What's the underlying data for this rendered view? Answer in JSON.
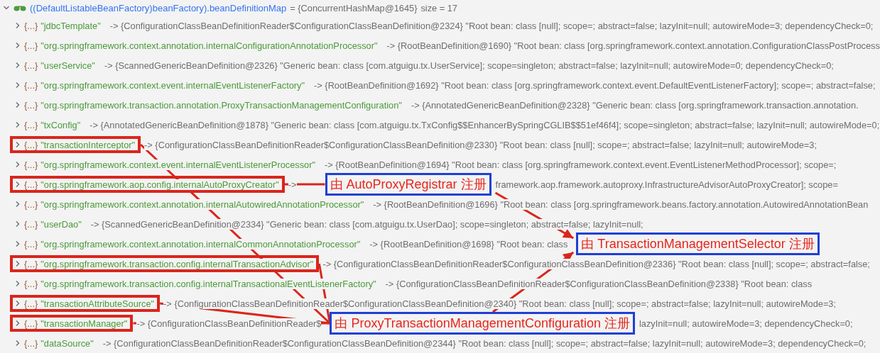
{
  "header": {
    "expression": "((DefaultListableBeanFactory)beanFactory).beanDefinitionMap",
    "value": "= {ConcurrentHashMap@1645}",
    "size": "size = 17",
    "expanded": true
  },
  "rows": [
    {
      "badge": "{...}",
      "key": "\"jdbcTemplate\"",
      "value": "-> {ConfigurationClassBeanDefinitionReader$ConfigurationClassBeanDefinition@2324} \"Root bean: class [null]; scope=; abstract=false; lazyInit=null; autowireMode=3; dependencyCheck=0;",
      "highlighted": false
    },
    {
      "badge": "{...}",
      "key": "\"org.springframework.context.annotation.internalConfigurationAnnotationProcessor\"",
      "value": "-> {RootBeanDefinition@1690} \"Root bean: class [org.springframework.context.annotation.ConfigurationClassPostProcess",
      "highlighted": false
    },
    {
      "badge": "{...}",
      "key": "\"userService\"",
      "value": "-> {ScannedGenericBeanDefinition@2326} \"Generic bean: class [com.atguigu.tx.UserService]; scope=singleton; abstract=false; lazyInit=null; autowireMode=0; dependencyCheck=0;",
      "highlighted": false
    },
    {
      "badge": "{...}",
      "key": "\"org.springframework.context.event.internalEventListenerFactory\"",
      "value": "-> {RootBeanDefinition@1692} \"Root bean: class [org.springframework.context.event.DefaultEventListenerFactory]; scope=; abstract=false;",
      "highlighted": false
    },
    {
      "badge": "{...}",
      "key": "\"org.springframework.transaction.annotation.ProxyTransactionManagementConfiguration\"",
      "value": "-> {AnnotatedGenericBeanDefinition@2328} \"Generic bean: class [org.springframework.transaction.annotation.",
      "highlighted": false
    },
    {
      "badge": "{...}",
      "key": "\"txConfig\"",
      "value": "-> {AnnotatedGenericBeanDefinition@1878} \"Generic bean: class [com.atguigu.tx.TxConfig$$EnhancerBySpringCGLIB$$51ef46f4]; scope=singleton; abstract=false; lazyInit=null; autowireMode=0;",
      "highlighted": false
    },
    {
      "badge": "{...}",
      "key": "\"transactionInterceptor\"",
      "value": "-> {ConfigurationClassBeanDefinitionReader$ConfigurationClassBeanDefinition@2330} \"Root bean: class [null]; scope=; abstract=false; lazyInit=null; autowireMode=3;",
      "highlighted": true
    },
    {
      "badge": "{...}",
      "key": "\"org.springframework.context.event.internalEventListenerProcessor\"",
      "value": "-> {RootBeanDefinition@1694} \"Root bean: class [org.springframework.context.event.EventListenerMethodProcessor]; scope=;",
      "highlighted": false
    },
    {
      "badge": "{...}",
      "key": "\"org.springframework.aop.config.internalAutoProxyCreator\"",
      "value": "->",
      "highlighted": true,
      "note": {
        "text": "由 AutoProxyRegistrar 注册"
      },
      "tail": "framework.aop.framework.autoproxy.InfrastructureAdvisorAutoProxyCreator]; scope="
    },
    {
      "badge": "{...}",
      "key": "\"org.springframework.context.annotation.internalAutowiredAnnotationProcessor\"",
      "value": "-> {RootBeanDefinition@1696} \"Root bean: class [org.springframework.beans.factory.annotation.AutowiredAnnotationBean",
      "highlighted": false
    },
    {
      "badge": "{...}",
      "key": "\"userDao\"",
      "value": "-> {ScannedGenericBeanDefinition@2334} \"Generic bean: class [com.atguigu.tx.UserDao]; scope=singleton; abstract=false; lazyInit=null;",
      "highlighted": false
    },
    {
      "badge": "{...}",
      "key": "\"org.springframework.context.annotation.internalCommonAnnotationProcessor\"",
      "value": "-> {RootBeanDefinition@1698} \"Root bean: class",
      "highlighted": false,
      "note": {
        "text": "由 TransactionManagementSelector 注册"
      }
    },
    {
      "badge": "{...}",
      "key": "\"org.springframework.transaction.config.internalTransactionAdvisor\"",
      "value": "-> {ConfigurationClassBeanDefinitionReader$ConfigurationClassBeanDefinition@2336} \"Root bean: class [null]; scope=; abstract=false;",
      "highlighted": true
    },
    {
      "badge": "{...}",
      "key": "\"org.springframework.transaction.config.internalTransactionalEventListenerFactory\"",
      "value": "-> {ConfigurationClassBeanDefinitionReader$ConfigurationClassBeanDefinition@2338} \"Root bean: class",
      "highlighted": false
    },
    {
      "badge": "{...}",
      "key": "\"transactionAttributeSource\"",
      "value": "-> {ConfigurationClassBeanDefinitionReader$ConfigurationClassBeanDefinition@2340} \"Root bean: class [null]; scope=; abstract=false; lazyInit=null; autowireMode=3;",
      "highlighted": true
    },
    {
      "badge": "{...}",
      "key": "\"transactionManager\"",
      "value": "-> {ConfigurationClassBeanDefinitionReader$",
      "highlighted": true,
      "note": {
        "text": "由 ProxyTransactionManagementConfiguration 注册"
      },
      "tail": "lazyInit=null; autowireMode=3; dependencyCheck=0;"
    },
    {
      "badge": "{...}",
      "key": "\"dataSource\"",
      "value": "-> {ConfigurationClassBeanDefinitionReader$ConfigurationClassBeanDefinition@2344} \"Root bean: class [null]; scope=; abstract=false; lazyInit=null; autowireMode=3; dependencyCheck=0;",
      "highlighted": false
    }
  ]
}
